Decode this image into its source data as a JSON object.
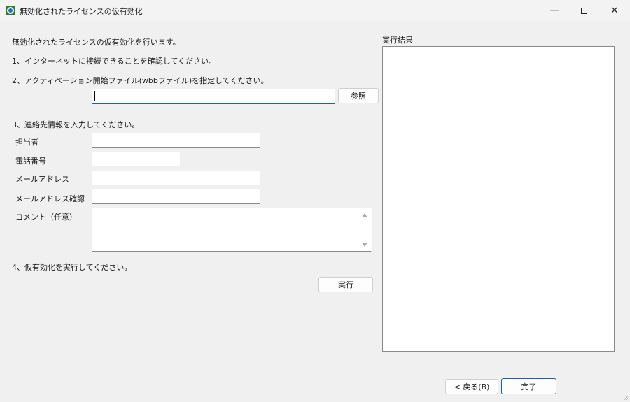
{
  "window": {
    "title": "無効化されたライセンスの仮有効化",
    "minimize_glyph": "—",
    "close_glyph": "✕"
  },
  "intro": "無効化されたライセンスの仮有効化を行います。",
  "step1": "1、インターネットに接続できることを確認してください。",
  "step2": {
    "label": "2、アクティベーション開始ファイル(wbbファイル)を指定してください。",
    "file_value": "",
    "browse_label": "参照"
  },
  "step3": {
    "label": "3、連絡先情報を入力してください。",
    "fields": {
      "person_label": "担当者",
      "phone_label": "電話番号",
      "email_label": "メールアドレス",
      "email_confirm_label": "メールアドレス確認",
      "comment_label": "コメント（任意）"
    }
  },
  "step4": {
    "label": "4、仮有効化を実行してください。",
    "execute_label": "実行"
  },
  "result": {
    "label": "実行結果",
    "text": ""
  },
  "footer": {
    "back_label": "< 戻る(B)",
    "finish_label": "完了"
  },
  "colors": {
    "focus_accent": "#1d5fb0",
    "window_bg": "#f0f0f0"
  }
}
